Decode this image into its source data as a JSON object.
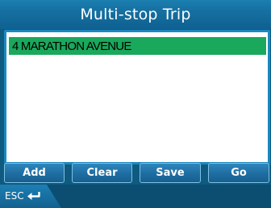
{
  "window": {
    "title": "Multi-stop Trip"
  },
  "trip_list": {
    "items": [
      {
        "label": "4 MARATHON AVENUE",
        "selected": true
      }
    ]
  },
  "toolbar": {
    "add_label": "Add",
    "clear_label": "Clear",
    "save_label": "Save",
    "go_label": "Go"
  },
  "footer": {
    "esc_label": "ESC",
    "esc_icon": "enter-arrow-icon"
  },
  "colors": {
    "background": "#0e5a80",
    "title_bar": "#156fa0",
    "list_border": "#1b89c0",
    "selected_row": "#1aa85c",
    "button": "#1f6fa3"
  }
}
